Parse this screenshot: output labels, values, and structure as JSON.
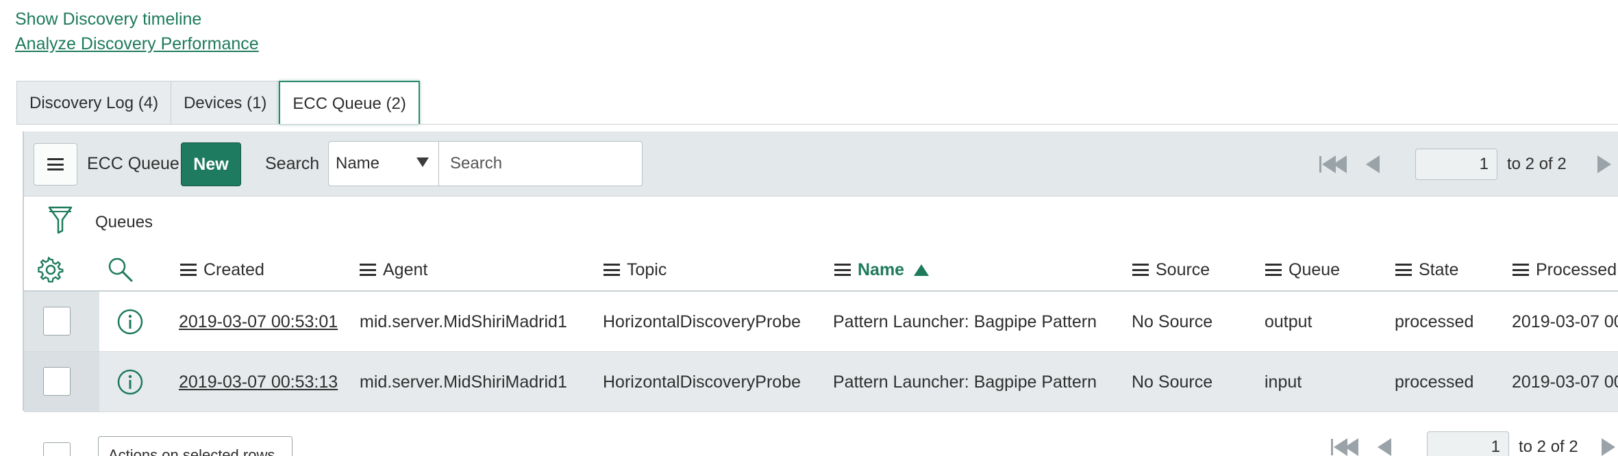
{
  "links": {
    "show_timeline": "Show Discovery timeline",
    "analyze_performance": "Analyze Discovery Performance"
  },
  "tabs": [
    {
      "label": "Discovery Log (4)",
      "active": false
    },
    {
      "label": "Devices (1)",
      "active": false
    },
    {
      "label": "ECC Queue (2)",
      "active": true
    }
  ],
  "toolbar": {
    "list_title": "ECC Queue",
    "new_label": "New",
    "search_label": "Search",
    "search_field": "Name",
    "search_placeholder": "Search",
    "page_value": "1",
    "page_of": "to 2 of 2"
  },
  "breadcrumb": "Queues",
  "columns": [
    "Created",
    "Agent",
    "Topic",
    "Name",
    "Source",
    "Queue",
    "State",
    "Processed"
  ],
  "sorted_column": "Name",
  "rows": [
    {
      "created": "2019-03-07 00:53:01",
      "agent": "mid.server.MidShiriMadrid1",
      "topic": "HorizontalDiscoveryProbe",
      "name": "Pattern Launcher: Bagpipe Pattern",
      "source": "No Source",
      "queue": "output",
      "state": "processed",
      "processed": "2019-03-07 00:"
    },
    {
      "created": "2019-03-07 00:53:13",
      "agent": "mid.server.MidShiriMadrid1",
      "topic": "HorizontalDiscoveryProbe",
      "name": "Pattern Launcher: Bagpipe Pattern",
      "source": "No Source",
      "queue": "input",
      "state": "processed",
      "processed": "2019-03-07 00:"
    }
  ],
  "footer": {
    "actions_label": "Actions on selected rows...",
    "page_value": "1",
    "page_of": "to 2 of 2"
  },
  "colors": {
    "accent": "#1d7a5c",
    "new_button": "#1f7b5f",
    "toolbar_bg": "#e3e8ea"
  }
}
